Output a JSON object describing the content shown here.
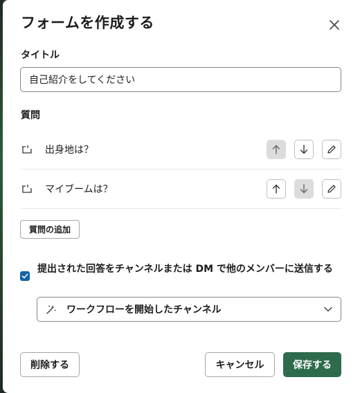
{
  "modal": {
    "title": "フォームを作成する",
    "close_icon": "close-icon"
  },
  "title_section": {
    "label": "タイトル",
    "input_value": "自己紹介をしてください"
  },
  "questions_section": {
    "label": "質問",
    "items": [
      {
        "label": "出身地は？",
        "up_disabled": true,
        "down_disabled": false
      },
      {
        "label": "マイブームは？",
        "up_disabled": false,
        "down_disabled": true
      }
    ],
    "add_label": "質問の追加"
  },
  "send_option": {
    "checked": true,
    "label": "提出された回答をチャンネルまたは DM で他のメンバーに送信する",
    "select_value": "ワークフローを開始したチャンネル",
    "select_icon": "workflow-icon"
  },
  "footer": {
    "delete_label": "削除する",
    "cancel_label": "キャンセル",
    "save_label": "保存する"
  },
  "colors": {
    "primary": "#2e6b4d",
    "checkbox": "#1264a3"
  }
}
